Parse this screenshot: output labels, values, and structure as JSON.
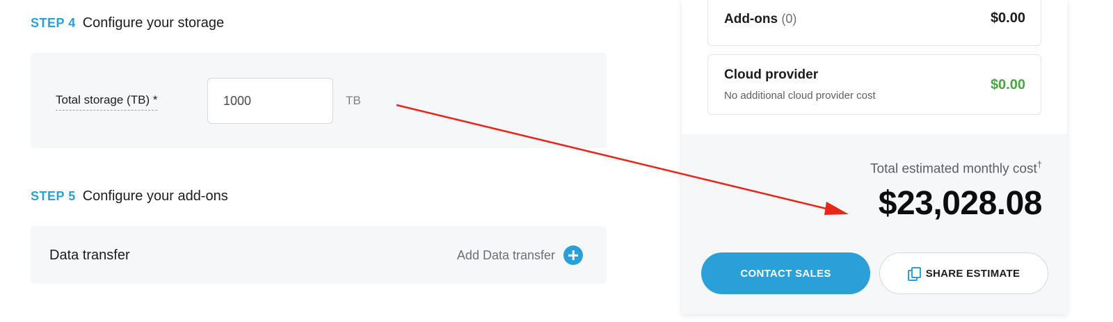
{
  "steps": {
    "storage": {
      "step_label": "STEP 4",
      "title": "Configure your storage"
    },
    "addons": {
      "step_label": "STEP 5",
      "title": "Configure your add-ons"
    }
  },
  "storage": {
    "label": "Total storage (TB) *",
    "value": "1000",
    "unit": "TB"
  },
  "addons": {
    "item_label": "Data transfer",
    "action_label": "Add Data transfer",
    "action_icon": "plus-circle-icon"
  },
  "summary": {
    "addons_line": {
      "title": "Add-ons",
      "count": "(0)",
      "price": "$0.00"
    },
    "cloud_line": {
      "title": "Cloud provider",
      "subtitle": "No additional cloud provider cost",
      "price": "$0.00"
    },
    "total_label": "Total estimated monthly cost",
    "total_marker": "†",
    "total_value": "$23,028.08",
    "contact_button": "CONTACT SALES",
    "share_button": "SHARE ESTIMATE",
    "share_icon": "copy-icon"
  },
  "colors": {
    "accent": "#2a9fd8",
    "positive": "#4aa544",
    "annotation": "#e8261a",
    "panel_bg": "#f6f7f9"
  }
}
